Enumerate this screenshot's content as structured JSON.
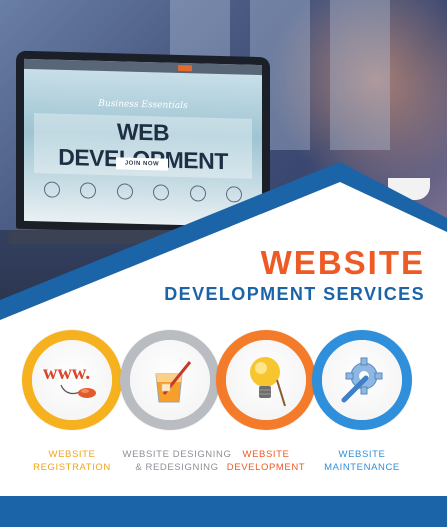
{
  "laptop_screen": {
    "tagline": "Business Essentials",
    "headline": "WEB DEVELOPMENT",
    "button_label": "JOIN NOW"
  },
  "title": {
    "line1": "WEBSITE",
    "line2": "DEVELOPMENT SERVICES"
  },
  "services": [
    {
      "label": "WEBSITE\nREGISTRATION",
      "icon": "www-mouse-icon",
      "ring_color": "#f6b11f"
    },
    {
      "label": "WEBSITE DESIGNING\n& REDESIGNING",
      "icon": "glass-pen-icon",
      "ring_color": "#b9bcc1"
    },
    {
      "label": "WEBSITE\nDEVELOPMENT",
      "icon": "lightbulb-icon",
      "ring_color": "#f37b2a"
    },
    {
      "label": "WEBSITE\nMAINTENANCE",
      "icon": "gear-wrench-icon",
      "ring_color": "#2f8fdb"
    }
  ],
  "colors": {
    "accent_orange": "#ef5a24",
    "brand_blue": "#1b64a8"
  }
}
